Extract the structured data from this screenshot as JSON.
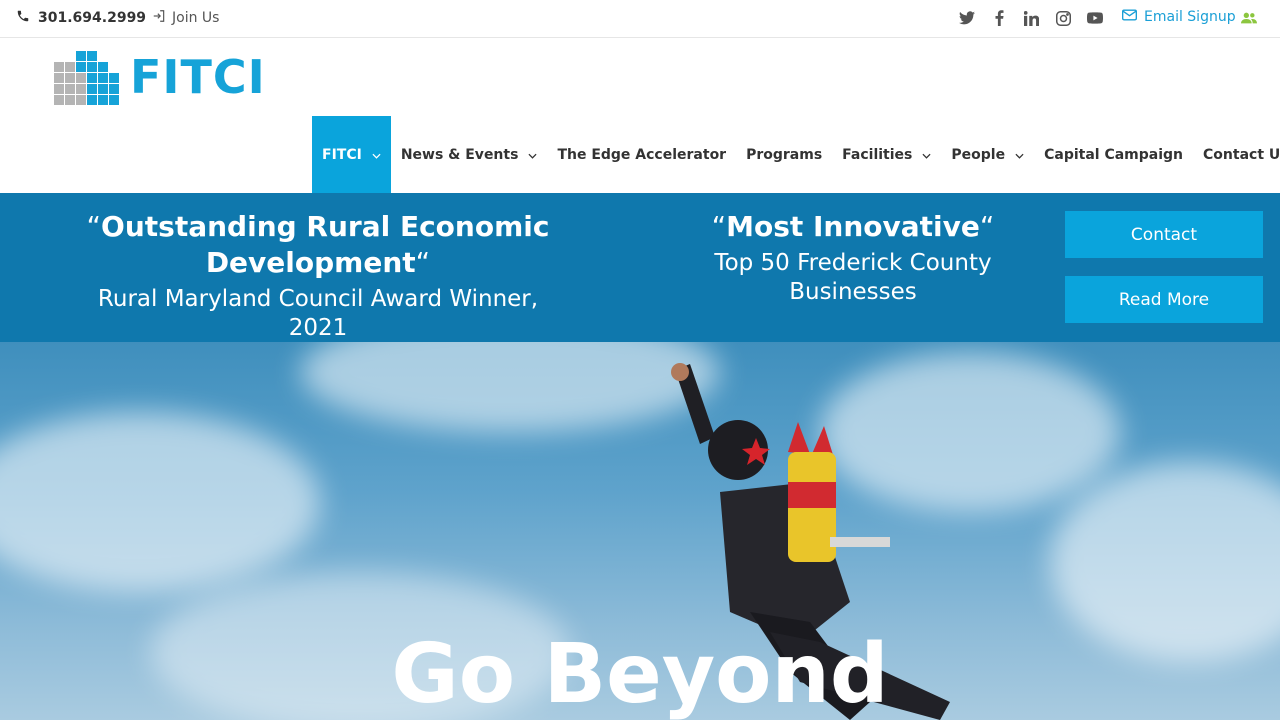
{
  "topbar": {
    "phone": "301.694.2999",
    "join": "Join Us",
    "email": "Email Signup",
    "social": [
      "twitter-icon",
      "facebook-icon",
      "linkedin-icon",
      "instagram-icon",
      "youtube-icon"
    ]
  },
  "logo": {
    "text": "FITCI"
  },
  "nav": {
    "items": [
      {
        "label": "FITCI",
        "dropdown": true
      },
      {
        "label": "News & Events",
        "dropdown": true
      },
      {
        "label": "The Edge Accelerator",
        "dropdown": false
      },
      {
        "label": "Programs",
        "dropdown": false
      },
      {
        "label": "Facilities",
        "dropdown": true
      },
      {
        "label": "People",
        "dropdown": true
      },
      {
        "label": "Capital Campaign",
        "dropdown": false
      },
      {
        "label": "Contact Us",
        "dropdown": false
      }
    ]
  },
  "awards": {
    "open_quote": "“",
    "close_quote": "“",
    "award1_title": "Outstanding Rural Economic Development",
    "award1_sub": "Rural Maryland Council Award Winner, 2021",
    "award2_title": "Most Innovative",
    "award2_sub": "Top 50 Frederick County Businesses"
  },
  "buttons": {
    "contact": "Contact",
    "read_more": "Read More"
  },
  "hero": {
    "title": "Go Beyond"
  },
  "colors": {
    "brand": "#16a3d8",
    "band": "#0f78ad",
    "button": "#0aa4dc",
    "users_icon": "#8cc63f"
  }
}
